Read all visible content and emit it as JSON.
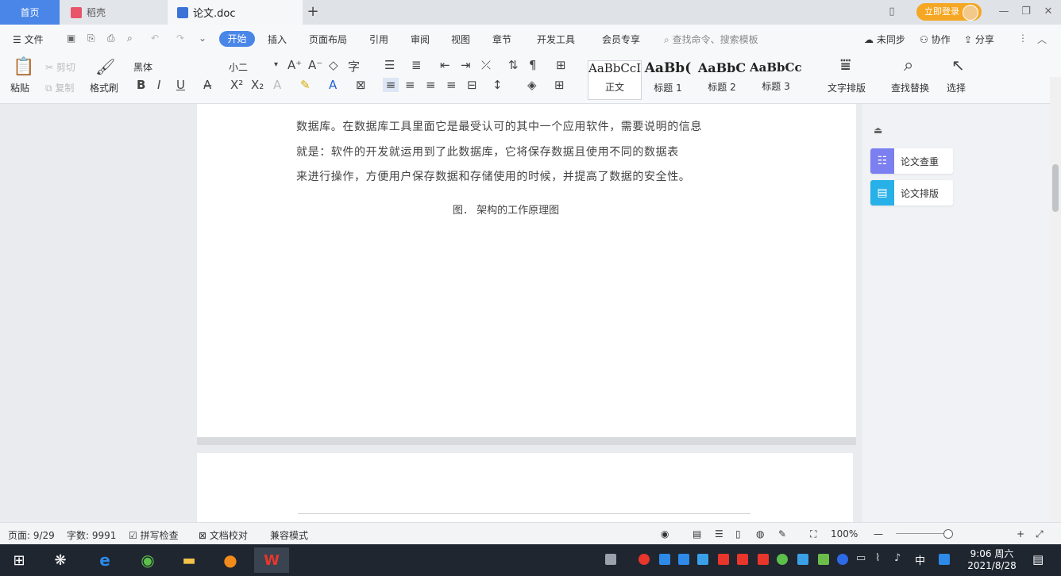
{
  "titlebar": {
    "tabs": [
      {
        "label": "首页"
      },
      {
        "label": "稻壳"
      },
      {
        "label": "论文.doc"
      }
    ],
    "add_tab": "+",
    "login": "立即登录"
  },
  "menubar": {
    "file": "文件",
    "items": [
      "开始",
      "插入",
      "页面布局",
      "引用",
      "审阅",
      "视图",
      "章节",
      "开发工具",
      "会员专享"
    ],
    "search_placeholder": "查找命令、搜索模板",
    "sync": "未同步",
    "collab": "协作",
    "share": "分享"
  },
  "ribbon": {
    "paste": "粘贴",
    "cut": "剪切",
    "copy": "复制",
    "format_painter": "格式刷",
    "font_name": "黑体",
    "font_size": "小二",
    "styles": [
      {
        "preview": "AaBbCcI",
        "name": "正文"
      },
      {
        "preview": "AaBb(",
        "name": "标题 1"
      },
      {
        "preview": "AaBbC",
        "name": "标题 2"
      },
      {
        "preview": "AaBbCcI",
        "name": "标题 3"
      }
    ],
    "text_layout": "文字排版",
    "find_replace": "查找替换",
    "select": "选择"
  },
  "document": {
    "lines": [
      "数据库。在数据库工具里面它是最受认可的其中一个应用软件，需要说明的信息",
      "就是：软件的开发就运用到了此数据库，它将保存数据且使用不同的数据表",
      "来进行操作，方便用户保存数据和存储使用的时候，并提高了数据的安全性。"
    ],
    "caption": "图．     架构的工作原理图"
  },
  "right_panel": {
    "check": "论文查重",
    "layout": "论文排版"
  },
  "statusbar": {
    "page": "页面: 9/29",
    "words": "字数: 9991",
    "spell": "拼写检查",
    "proof": "文档校对",
    "compat": "兼容模式",
    "zoom": "100%"
  },
  "taskbar": {
    "time": "9:06 周六",
    "date": "2021/8/28",
    "ime": "中"
  },
  "colors": {
    "accent": "#4a86e8",
    "login": "#f5a623",
    "check_icon": "#7b7ff0",
    "layout_icon": "#28b0e8"
  }
}
